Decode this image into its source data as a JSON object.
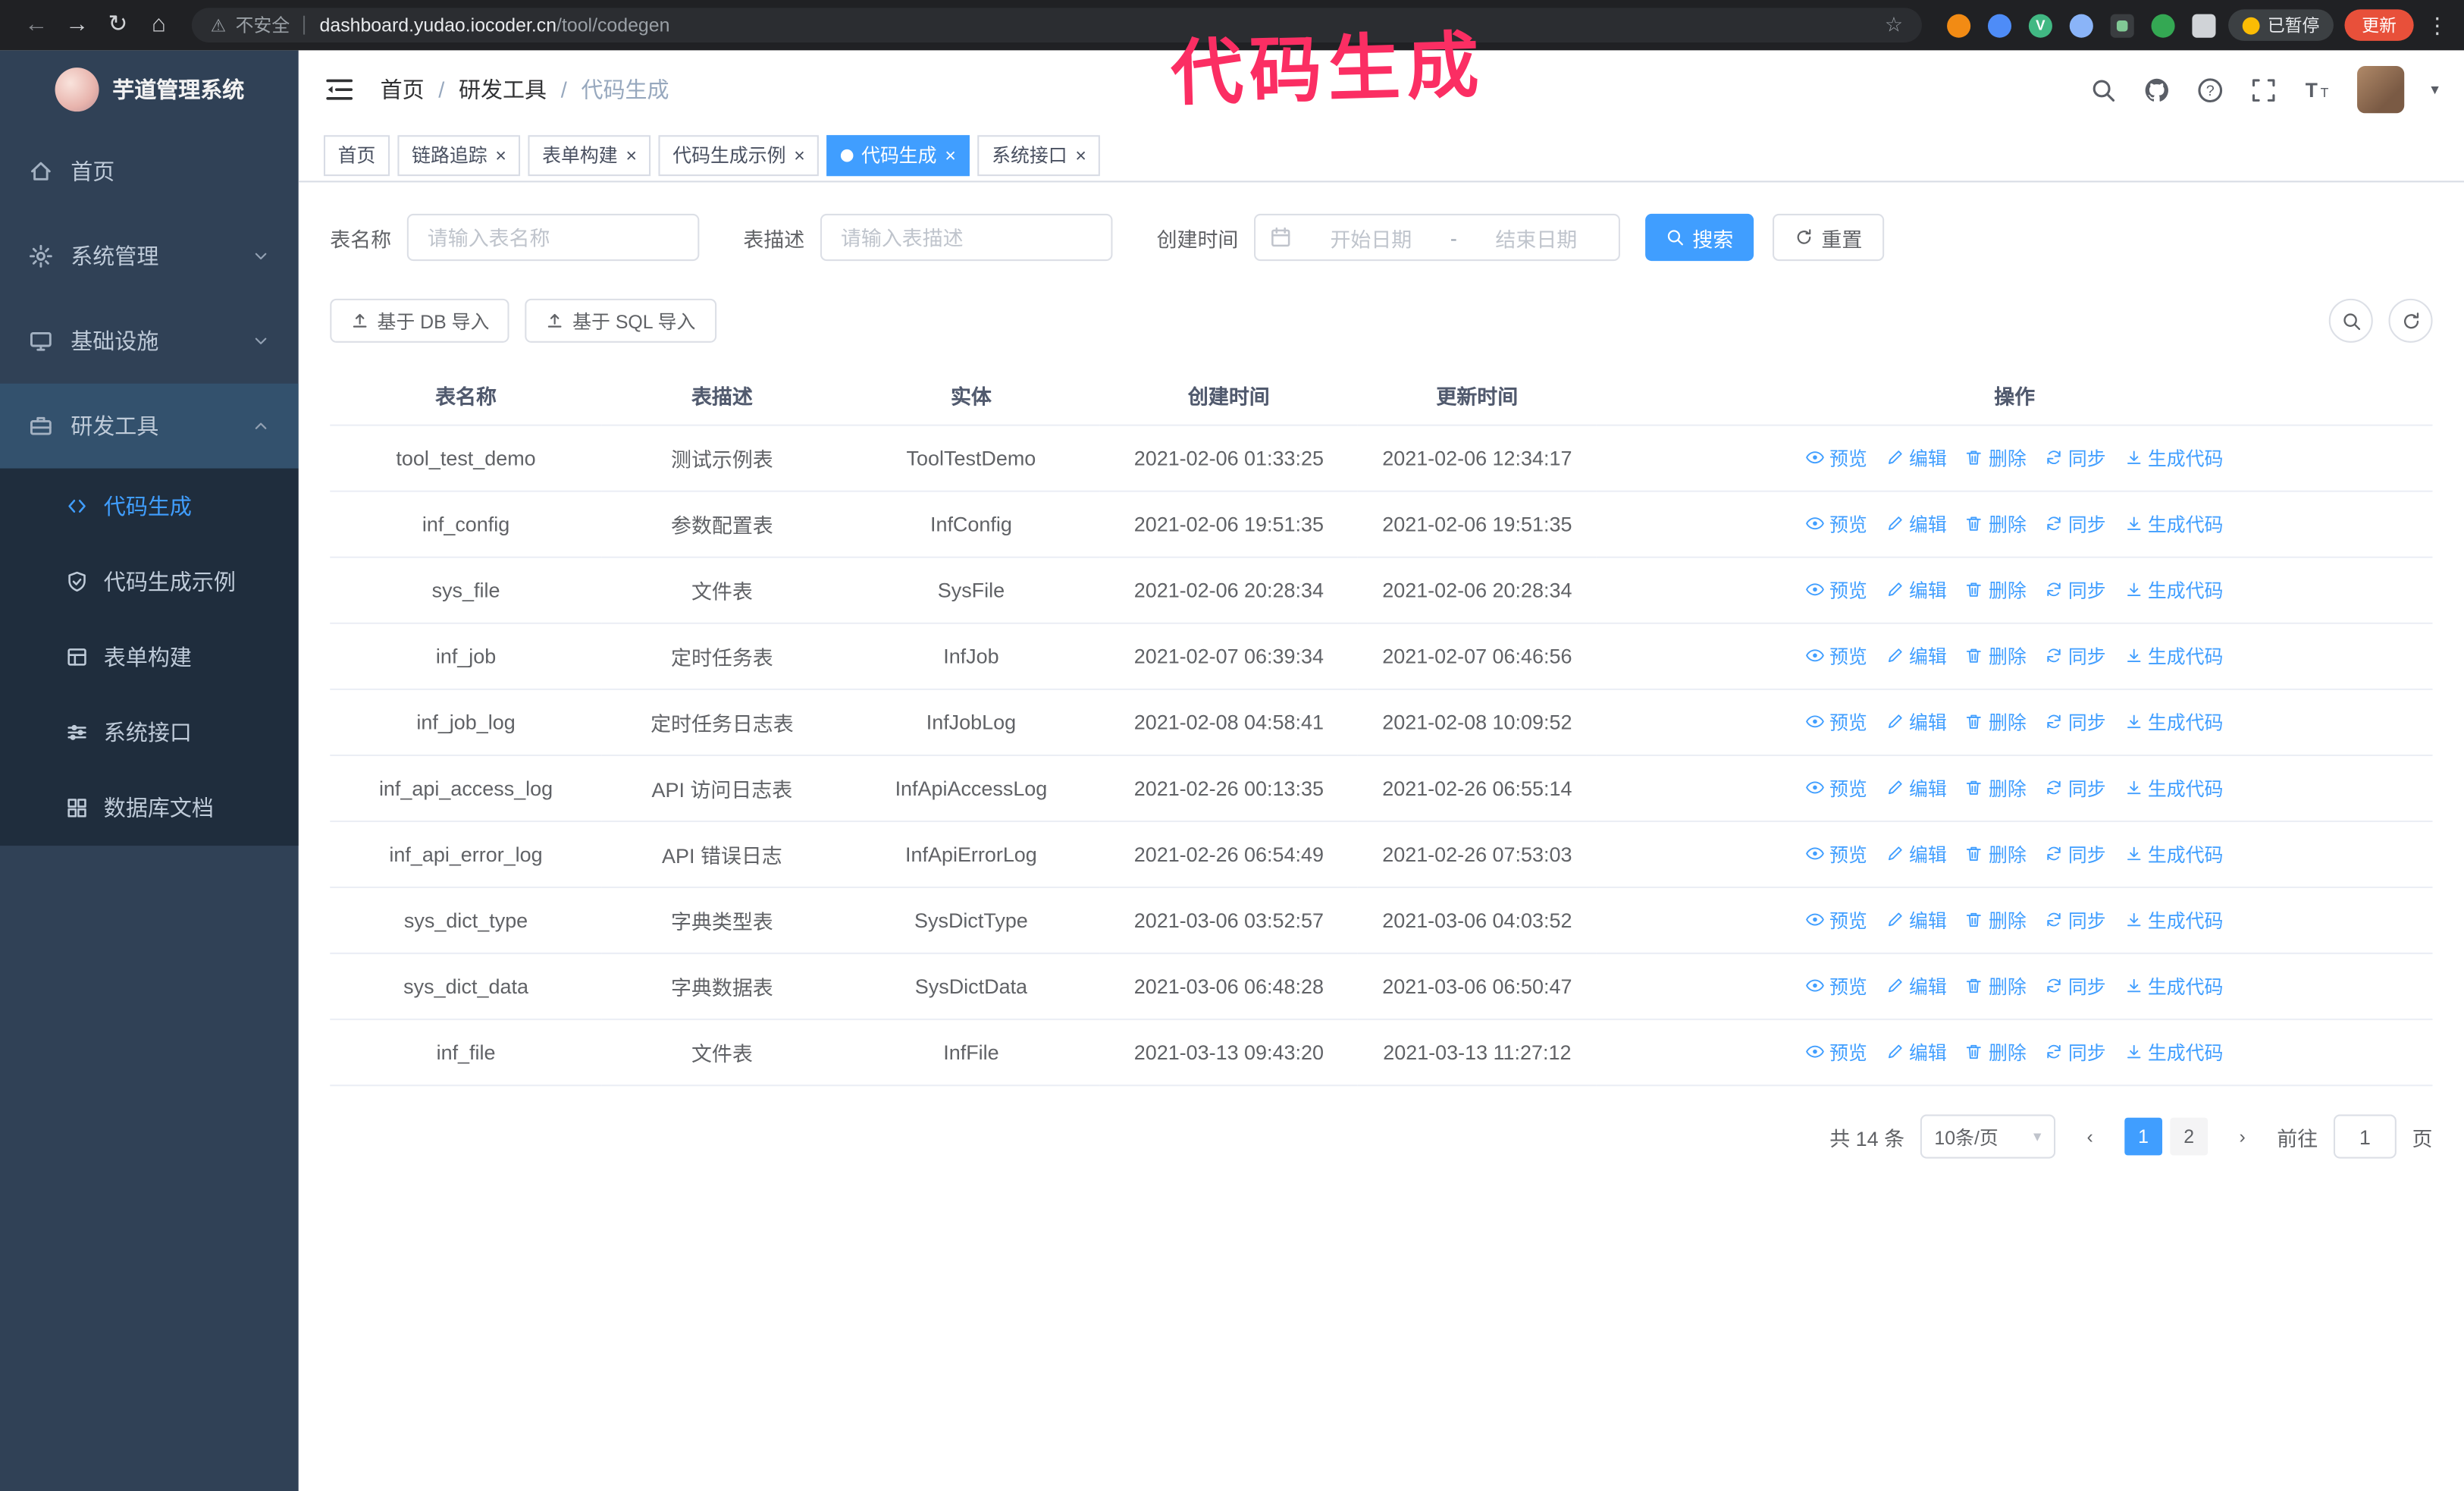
{
  "colors": {
    "accent": "#409eff",
    "annotation": "#fb2e63",
    "sidebar_bg": "#304156",
    "submenu_bg": "#1f2d3d",
    "chrome_bg": "#202124",
    "update_button_bg": "#e8503a"
  },
  "glyphs": {
    "back": "←",
    "forward": "→",
    "reload": "↻",
    "home": "⌂",
    "warning": "⚠",
    "star": "☆",
    "kebab": "⋮",
    "close": "×",
    "caret_down": "▾",
    "prev": "‹",
    "next": "›"
  },
  "browser": {
    "security_label": "不安全",
    "url_host": "dashboard.yudao.iocoder.cn",
    "url_path": "/tool/codegen",
    "paused_badge": "已暂停",
    "update_button": "更新"
  },
  "annotation": {
    "text": "代码生成"
  },
  "sidebar": {
    "logo_title": "芋道管理系统",
    "items": [
      {
        "label": "首页",
        "expandable": false,
        "expanded": false
      },
      {
        "label": "系统管理",
        "expandable": true,
        "expanded": false
      },
      {
        "label": "基础设施",
        "expandable": true,
        "expanded": false
      },
      {
        "label": "研发工具",
        "expandable": true,
        "expanded": true
      }
    ],
    "sub_items": [
      {
        "label": "代码生成",
        "active": true
      },
      {
        "label": "代码生成示例",
        "active": false
      },
      {
        "label": "表单构建",
        "active": false
      },
      {
        "label": "系统接口",
        "active": false
      },
      {
        "label": "数据库文档",
        "active": false
      }
    ]
  },
  "header": {
    "breadcrumb": [
      "首页",
      "研发工具",
      "代码生成"
    ],
    "separator": "/"
  },
  "tabs": [
    {
      "label": "首页",
      "closable": false,
      "active": false
    },
    {
      "label": "链路追踪",
      "closable": true,
      "active": false
    },
    {
      "label": "表单构建",
      "closable": true,
      "active": false
    },
    {
      "label": "代码生成示例",
      "closable": true,
      "active": false
    },
    {
      "label": "代码生成",
      "closable": true,
      "active": true
    },
    {
      "label": "系统接口",
      "closable": true,
      "active": false
    }
  ],
  "filters": {
    "table_name_label": "表名称",
    "table_name_placeholder": "请输入表名称",
    "table_desc_label": "表描述",
    "table_desc_placeholder": "请输入表描述",
    "create_time_label": "创建时间",
    "date_start_placeholder": "开始日期",
    "date_separator": "-",
    "date_end_placeholder": "结束日期",
    "search_button": "搜索",
    "reset_button": "重置"
  },
  "toolbar": {
    "import_db_button": "基于 DB 导入",
    "import_sql_button": "基于 SQL 导入"
  },
  "table": {
    "headers": [
      "表名称",
      "表描述",
      "实体",
      "创建时间",
      "更新时间",
      "操作"
    ],
    "actions": [
      "预览",
      "编辑",
      "删除",
      "同步",
      "生成代码"
    ],
    "rows": [
      {
        "name": "tool_test_demo",
        "desc": "测试示例表",
        "entity": "ToolTestDemo",
        "created": "2021-02-06 01:33:25",
        "updated": "2021-02-06 12:34:17"
      },
      {
        "name": "inf_config",
        "desc": "参数配置表",
        "entity": "InfConfig",
        "created": "2021-02-06 19:51:35",
        "updated": "2021-02-06 19:51:35"
      },
      {
        "name": "sys_file",
        "desc": "文件表",
        "entity": "SysFile",
        "created": "2021-02-06 20:28:34",
        "updated": "2021-02-06 20:28:34"
      },
      {
        "name": "inf_job",
        "desc": "定时任务表",
        "entity": "InfJob",
        "created": "2021-02-07 06:39:34",
        "updated": "2021-02-07 06:46:56"
      },
      {
        "name": "inf_job_log",
        "desc": "定时任务日志表",
        "entity": "InfJobLog",
        "created": "2021-02-08 04:58:41",
        "updated": "2021-02-08 10:09:52"
      },
      {
        "name": "inf_api_access_log",
        "desc": "API 访问日志表",
        "entity": "InfApiAccessLog",
        "created": "2021-02-26 00:13:35",
        "updated": "2021-02-26 06:55:14"
      },
      {
        "name": "inf_api_error_log",
        "desc": "API 错误日志",
        "entity": "InfApiErrorLog",
        "created": "2021-02-26 06:54:49",
        "updated": "2021-02-26 07:53:03"
      },
      {
        "name": "sys_dict_type",
        "desc": "字典类型表",
        "entity": "SysDictType",
        "created": "2021-03-06 03:52:57",
        "updated": "2021-03-06 04:03:52"
      },
      {
        "name": "sys_dict_data",
        "desc": "字典数据表",
        "entity": "SysDictData",
        "created": "2021-03-06 06:48:28",
        "updated": "2021-03-06 06:50:47"
      },
      {
        "name": "inf_file",
        "desc": "文件表",
        "entity": "InfFile",
        "created": "2021-03-13 09:43:20",
        "updated": "2021-03-13 11:27:12"
      }
    ]
  },
  "pagination": {
    "total": "共 14 条",
    "page_size": "10条/页",
    "pages": [
      {
        "label": "1",
        "active": true
      },
      {
        "label": "2",
        "active": false
      }
    ],
    "goto_label": "前往",
    "goto_value": "1",
    "goto_suffix": "页"
  }
}
